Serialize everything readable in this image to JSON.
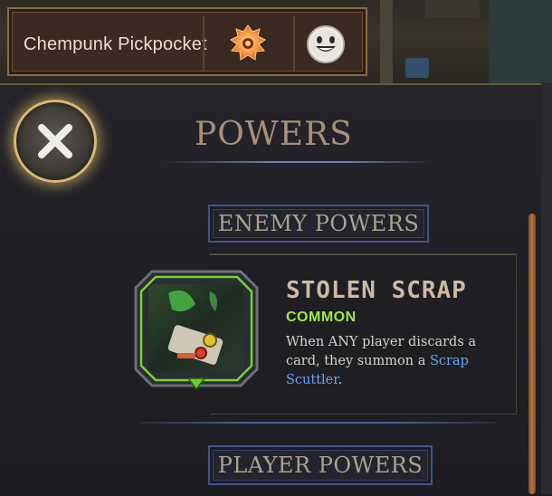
{
  "header": {
    "player_name": "Chempunk Pickpocket",
    "icons": [
      "region-emblem-icon",
      "emote-smile-icon"
    ]
  },
  "close_button": {
    "icon": "close-icon"
  },
  "panel": {
    "title": "POWERS",
    "enemy_section_label": "ENEMY POWERS",
    "player_section_label": "PLAYER POWERS"
  },
  "power": {
    "name": "STOLEN SCRAP",
    "rarity": "COMMON",
    "description_pre": "When ANY player discards a card, they summon a ",
    "description_link": "Scrap Scuttler",
    "description_post": ".",
    "rarity_color": "#9ee84a",
    "link_color": "#5fa8f0"
  }
}
